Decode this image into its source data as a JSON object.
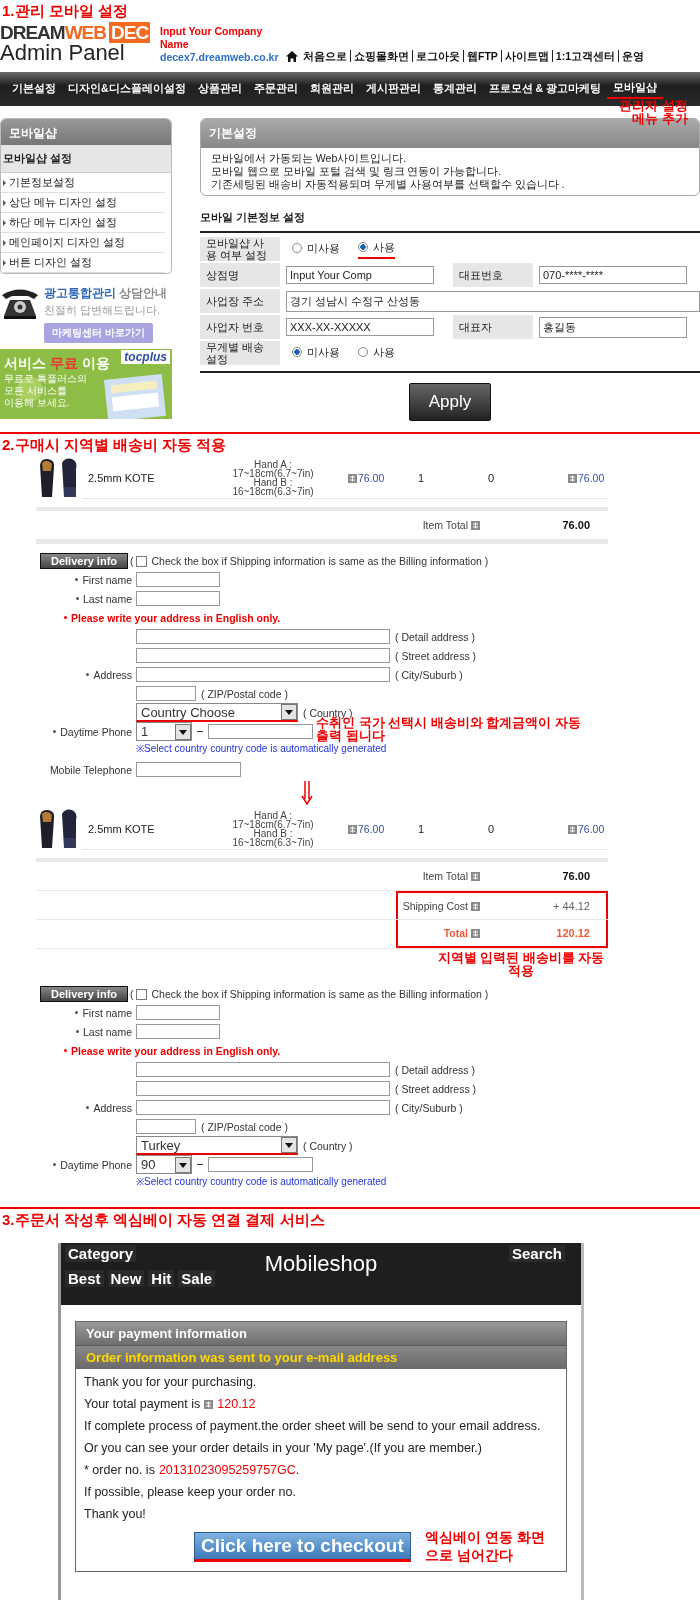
{
  "admin": {
    "heading": "1.관리 모바일 설정",
    "logo": {
      "parts": [
        "DREAM",
        "WEB",
        "DEC"
      ],
      "subtitle": "Admin Panel"
    },
    "company": {
      "name": "Input Your Company Name",
      "domain": "decex7.dreamweb.co.kr"
    },
    "top_links": [
      "처음으로",
      "쇼핑몰화면",
      "로그아웃",
      "웹FTP",
      "사이트맵",
      "1:1고객센터",
      "운영"
    ],
    "nav": [
      {
        "label": "기본설정",
        "underlined": false
      },
      {
        "label": "디자인&디스플레이설정",
        "underlined": false
      },
      {
        "label": "상품관리",
        "underlined": false
      },
      {
        "label": "주문관리",
        "underlined": false
      },
      {
        "label": "회원관리",
        "underlined": false
      },
      {
        "label": "게시판관리",
        "underlined": false
      },
      {
        "label": "통계관리",
        "underlined": false
      },
      {
        "label": "프로모션 & 광고마케팅",
        "underlined": false
      },
      {
        "label": "모바일샵",
        "underlined": true
      }
    ],
    "nav_note": "관리자 설정 메뉴 추가",
    "sidebar": {
      "title": "모바일샵",
      "group": "모바일샵 설정",
      "items": [
        "기본정보설정",
        "상단 메뉴 디자인 설정",
        "하단 메뉴 디자인 설정",
        "메인페이지 디자인 설정",
        "버튼 디자인 설정"
      ]
    },
    "ad": {
      "title": "광고통합관리",
      "title_rest": "상담안내",
      "subtitle": "친절히 답변해드립니다.",
      "button": "마케팅센터 바로가기"
    },
    "banner": {
      "logo": "tocplus",
      "title": [
        {
          "text": "서비스",
          "highlight": false
        },
        {
          "text": "무료",
          "highlight": true
        },
        {
          "text": "이용",
          "highlight": false
        }
      ],
      "lines": [
        "무료로 톡플러스의",
        "모든 서비스를",
        "이용해 보세요."
      ]
    },
    "panel": {
      "title": "기본설정",
      "lines": [
        "모바일에서 가동되는 Web사이트입니다.",
        "모바일 웹으로 모바일 포털 검색 및 링크 연동이 가능합니다.",
        "기존세팅된 배송비 자동적용되며 무게별 사용여부를 선택할수 있습니다 ."
      ]
    },
    "form": {
      "title": "모바일 기본정보 설정",
      "rows": [
        {
          "kind": "radio",
          "label": "모바일샵 사용 여부 설정",
          "options": [
            {
              "label": "미사용",
              "selected": false,
              "underlined": false
            },
            {
              "label": "사용",
              "selected": true,
              "underlined": true
            }
          ]
        },
        {
          "kind": "pair",
          "fields": [
            {
              "label": "상점명",
              "value": "Input Your Comp"
            },
            {
              "label": "대표번호",
              "value": "070-****-****"
            }
          ]
        },
        {
          "kind": "wide",
          "fields": [
            {
              "label": "사업장 주소",
              "value": "경기 성남시 수정구 산성동"
            }
          ]
        },
        {
          "kind": "pair",
          "fields": [
            {
              "label": "사업자 번호",
              "value": "XXX-XX-XXXXX"
            },
            {
              "label": "대표자",
              "value": "홍길동"
            }
          ]
        },
        {
          "kind": "radio",
          "label": "무게별 배송설정",
          "options": [
            {
              "label": "미사용",
              "selected": true,
              "underlined": false
            },
            {
              "label": "사용",
              "selected": false,
              "underlined": false
            }
          ]
        }
      ]
    },
    "apply": "Apply"
  },
  "checkout_flow": {
    "heading": "2.구매시 지역별 배송비 자동 적용",
    "steps": [
      {
        "item": {
          "name": "2.5mm KOTE",
          "options": [
            "Hand A :",
            "17~18cm(6.7~7in)",
            "Hand B :",
            "16~18cm(6.3~7in)"
          ],
          "price": "76.00",
          "qty": "1",
          "column_5": "0",
          "total": "76.00"
        },
        "summary": [
          {
            "kind": "item_total",
            "label": "Item Total",
            "value": "76.00"
          }
        ],
        "delivery": {
          "button": "Delivery info",
          "paren": "(",
          "same_as_billing": {
            "checked": false,
            "label": "Check the box if Shipping information is same as the Billing information )"
          },
          "first_name": "First name",
          "last_name": "Last name",
          "notice": "Please write your address in English only.",
          "address_label": "Address",
          "address_hints": [
            "( Detail address )",
            "( Street address )",
            "( City/Suburb )"
          ],
          "zip_hint": "( ZIP/Postal code )",
          "country": {
            "value": "Country Choose",
            "hint": "( Country )",
            "underlined": true
          },
          "phone": {
            "label": "Daytime Phone",
            "code": "1"
          },
          "phone_note": "※Select country country code is automatically generated",
          "mobile_label": "Mobile Telephone",
          "annotation": "수취인 국가 선택시 배송비와 합계금액이 자동 출력 됩니다"
        }
      },
      {
        "item": {
          "name": "2.5mm KOTE",
          "options": [
            "Hand A :",
            "17~18cm(6.7~7in)",
            "Hand B :",
            "16~18cm(6.3~7in)"
          ],
          "price": "76.00",
          "qty": "1",
          "column_5": "0",
          "total": "76.00"
        },
        "summary": [
          {
            "kind": "item_total",
            "label": "Item Total",
            "value": "76.00"
          },
          {
            "kind": "shipping",
            "label": "Shipping Cost",
            "value": "+ 44.12",
            "boxed": true
          },
          {
            "kind": "grand_total",
            "label": "Total",
            "value": "120.12",
            "boxed": true
          }
        ],
        "summary_note": "지역별 입력된 배송비를 자동 적용",
        "delivery": {
          "button": "Delivery info",
          "paren": "(",
          "same_as_billing": {
            "checked": false,
            "label": "Check the box if Shipping information is same as the Billing information )"
          },
          "first_name": "First name",
          "last_name": "Last name",
          "notice": "Please write your address in English only.",
          "address_label": "Address",
          "address_hints": [
            "( Detail address )",
            "( Street address )",
            "( City/Suburb )"
          ],
          "zip_hint": "( ZIP/Postal code )",
          "country": {
            "value": "Turkey",
            "hint": "( Country )",
            "underlined": true
          },
          "phone": {
            "label": "Daytime Phone",
            "code": "90"
          },
          "phone_note": "※Select country country code is automatically generated"
        }
      }
    ]
  },
  "payment": {
    "heading": "3.주문서 작성후 엑심베이 자동 연결 결제 서비스",
    "header": {
      "category": "Category",
      "title": "Mobileshop",
      "search": "Search",
      "tabs": [
        "Best",
        "New",
        "Hit",
        "Sale"
      ]
    },
    "title": "Your payment information",
    "subtitle": "Order information was sent to your e-mail address",
    "lines": [
      {
        "kind": "text",
        "text": "Thank you for your purchasing."
      },
      {
        "kind": "amount",
        "text": "Your total payment is",
        "value": "120.12"
      },
      {
        "kind": "text",
        "text": "If complete process of payment.the order sheet will be send to your email address."
      },
      {
        "kind": "text",
        "text": "Or you can see your order details in your 'My page'.(If you are member.)"
      },
      {
        "kind": "order",
        "prefix": "*",
        "text": "order no. is",
        "value": "20131023095259757GC",
        "suffix": "."
      },
      {
        "kind": "text",
        "text": "If possible, please keep your order no."
      },
      {
        "kind": "text",
        "text": "Thank you!"
      }
    ],
    "checkout": {
      "label": "Click here to checkout",
      "underlined": true
    },
    "note": "엑심베이 연동 화면으로 넘어간다"
  }
}
